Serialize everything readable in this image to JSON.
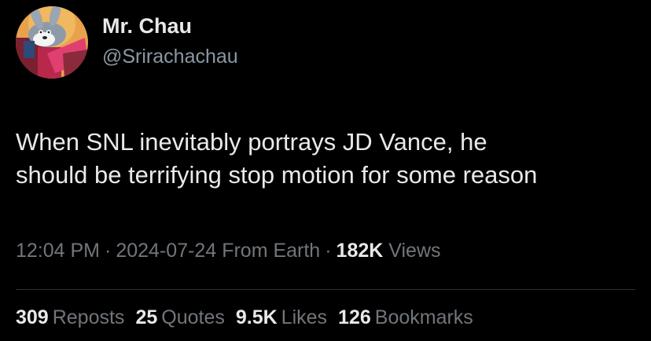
{
  "author": {
    "display_name": "Mr. Chau",
    "handle": "@Srirachachau",
    "avatar_icon": "cartoon-rabbit-avatar"
  },
  "tweet": {
    "text_lines": [
      "When SNL inevitably portrays JD Vance, he",
      "should be terrifying stop motion for some reason"
    ],
    "time": "12:04 PM",
    "date": "2024-07-24",
    "location": "From Earth",
    "views_count": "182K",
    "views_label": "Views"
  },
  "stats": {
    "reposts_count": "309",
    "reposts_label": "Reposts",
    "quotes_count": "25",
    "quotes_label": "Quotes",
    "likes_count": "9.5K",
    "likes_label": "Likes",
    "bookmarks_count": "126",
    "bookmarks_label": "Bookmarks"
  },
  "colors": {
    "background": "#000000",
    "primary_text": "#e7e9ea",
    "secondary_text": "#71767b",
    "divider": "#2f3336"
  }
}
